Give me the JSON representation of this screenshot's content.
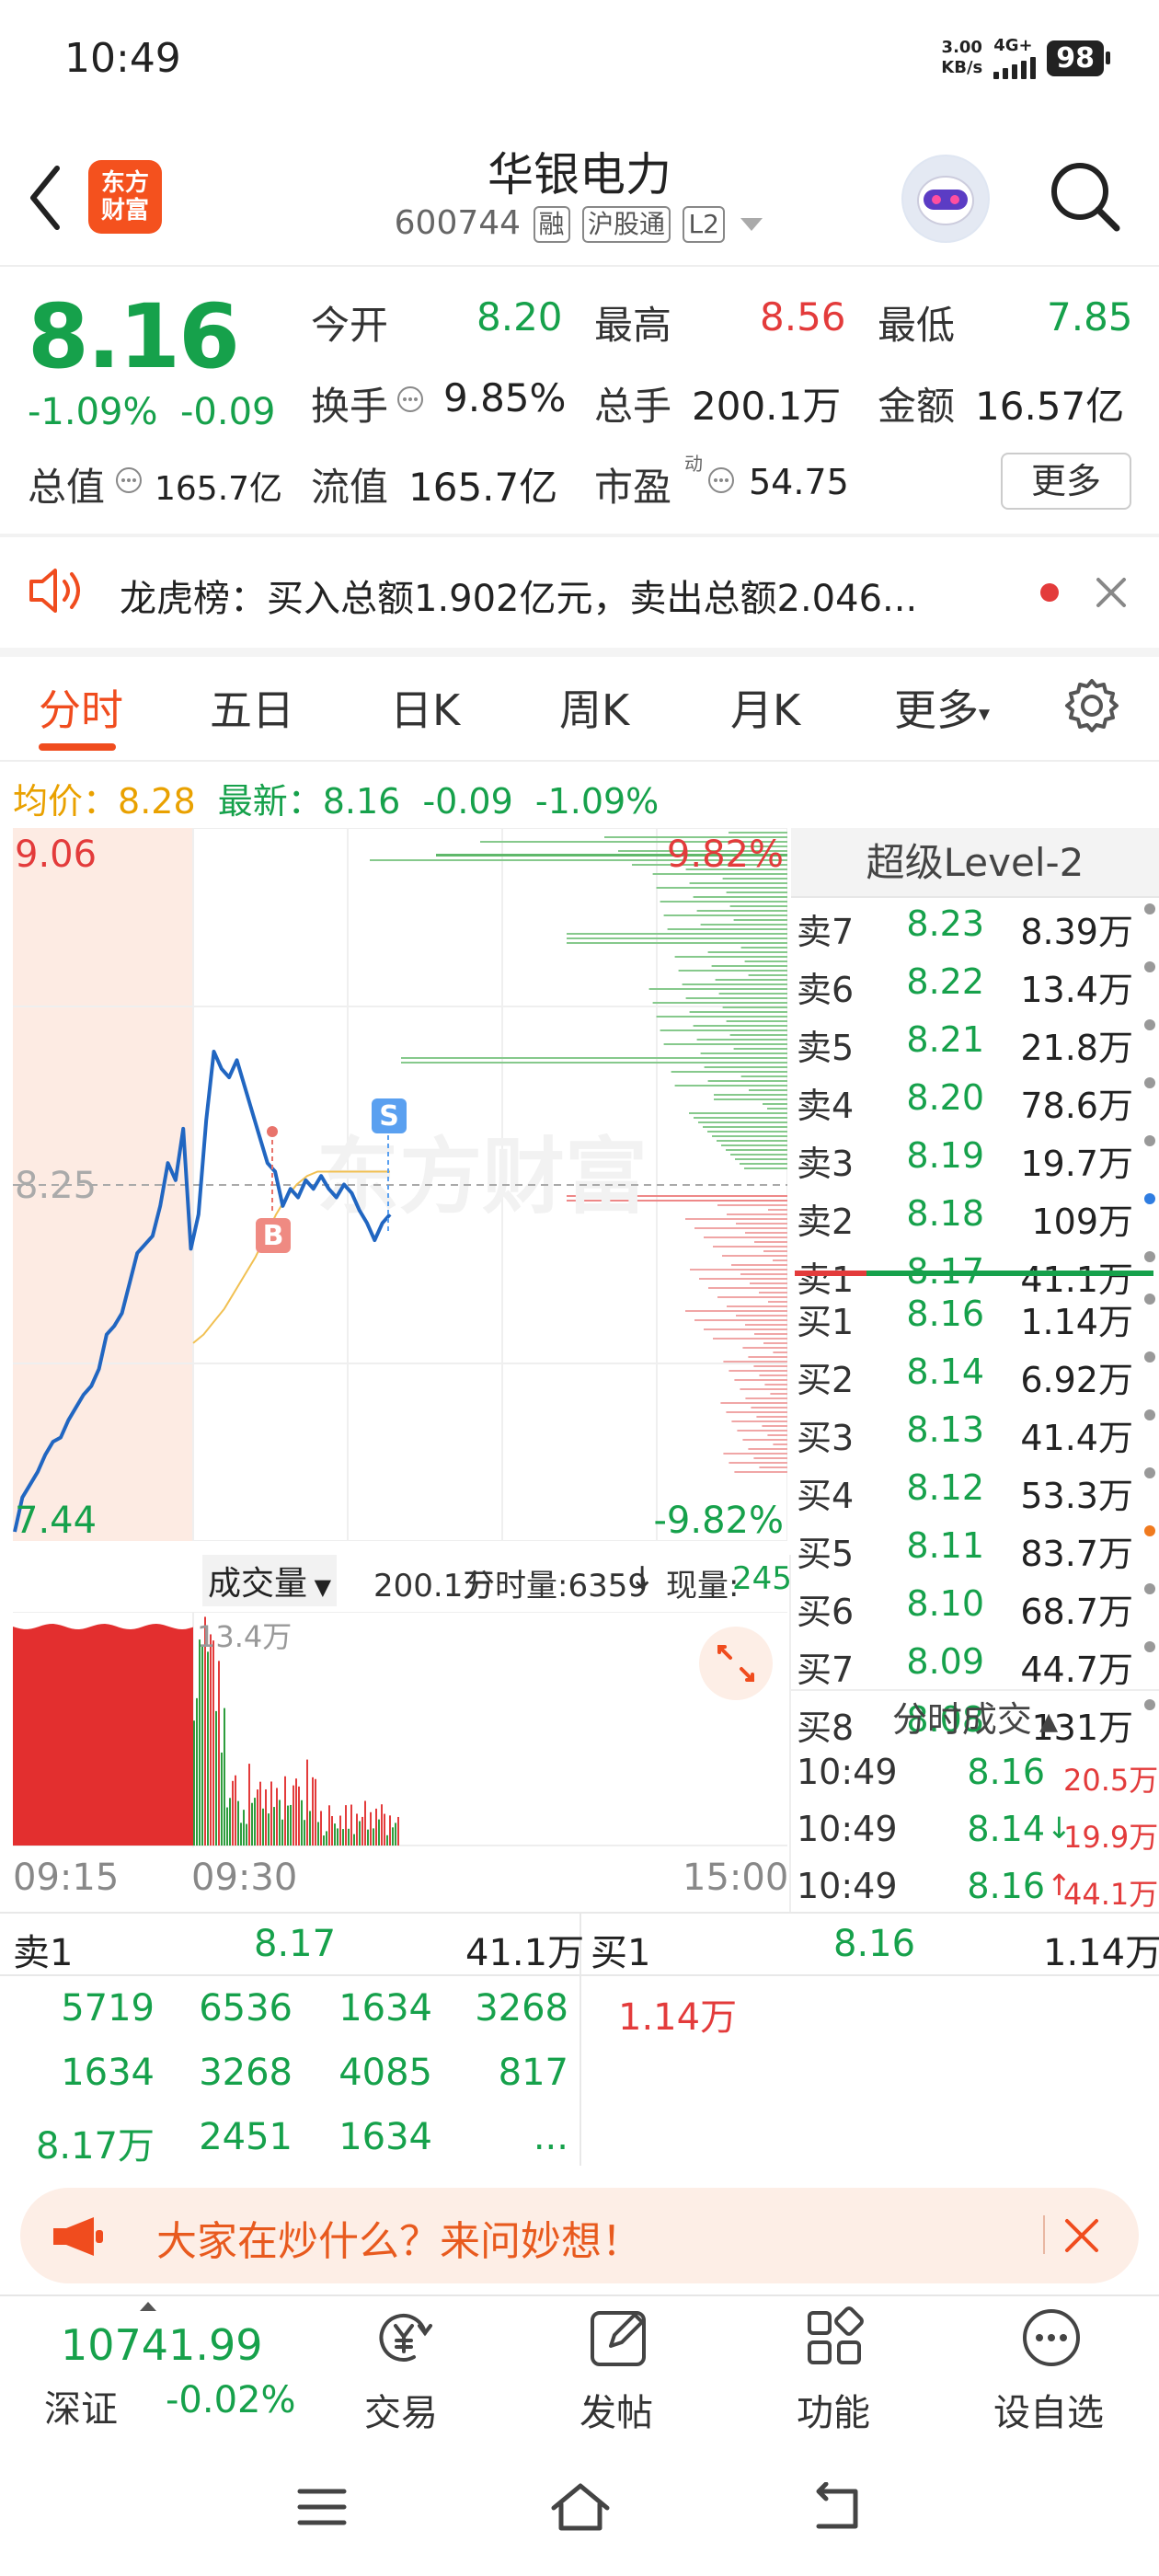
{
  "status_bar": {
    "time": "10:49",
    "speed_value": "3.00",
    "speed_unit": "KB/s",
    "network": "4G+",
    "battery": "98"
  },
  "header": {
    "title": "华银电力",
    "code": "600744",
    "tags": [
      "融",
      "沪股通",
      "L2"
    ],
    "logo_text": "东方财富"
  },
  "quote": {
    "price": "8.16",
    "change_pct": "-1.09%",
    "change": "-0.09",
    "fields": [
      {
        "label": "今开",
        "value": "8.20"
      },
      {
        "label": "最高",
        "value": "8.56"
      },
      {
        "label": "最低",
        "value": "7.85"
      },
      {
        "label": "换手",
        "value": "9.85%"
      },
      {
        "label": "总手",
        "value": "200.1万"
      },
      {
        "label": "金额",
        "value": "16.57亿"
      },
      {
        "label": "总值",
        "value": "165.7亿"
      },
      {
        "label": "流值",
        "value": "165.7亿"
      },
      {
        "label": "市盈",
        "value": "54.75"
      }
    ],
    "pe_superscript": "动",
    "more_button": "更多"
  },
  "news": {
    "text": "龙虎榜：买入总额1.902亿元，卖出总额2.046..."
  },
  "tabs": [
    "分时",
    "五日",
    "日K",
    "周K",
    "月K",
    "更多"
  ],
  "active_tab": "分时",
  "chart_info": {
    "avg_label": "均价：",
    "avg_value": "8.28",
    "latest_label": "最新：",
    "latest_value": "8.16",
    "change": "-0.09",
    "change_pct": "-1.09%"
  },
  "chart_data": {
    "type": "line",
    "title": "",
    "ylim": [
      7.44,
      9.06
    ],
    "y_labels": {
      "top": "9.06",
      "mid": "8.25",
      "bottom": "7.44"
    },
    "pct_labels": {
      "top": "9.82%",
      "bottom": "-9.82%"
    },
    "watermark": "东方财富",
    "x_labels": [
      "09:15",
      "09:30",
      "15:00"
    ],
    "series": [
      {
        "values": [
          7.44,
          7.52,
          7.55,
          7.58,
          7.62,
          7.65,
          7.66,
          7.7,
          7.73,
          7.76,
          7.78,
          7.82,
          7.9,
          7.92,
          7.95,
          8.02,
          8.09,
          8.11,
          8.13,
          8.2,
          8.3,
          8.26,
          8.38,
          8.1,
          8.18,
          8.4,
          8.56,
          8.52,
          8.5,
          8.54,
          8.48,
          8.42,
          8.36,
          8.3,
          8.28,
          8.2,
          8.24,
          8.22,
          8.26,
          8.24,
          8.27,
          8.24,
          8.22,
          8.25,
          8.23,
          8.19,
          8.16,
          8.12,
          8.16,
          8.18
        ]
      },
      {
        "values": [
          7.88,
          7.9,
          7.93,
          7.96,
          8.0,
          8.04,
          8.08,
          8.13,
          8.18,
          8.22,
          8.25,
          8.27,
          8.28,
          8.28,
          8.28,
          8.28,
          8.28,
          8.28,
          8.28,
          8.28
        ]
      }
    ],
    "markers": [
      {
        "label": "B"
      },
      {
        "label": "S"
      }
    ]
  },
  "order_book": {
    "title": "超级Level-2",
    "asks": [
      {
        "label": "卖7",
        "price": "8.23",
        "vol": "8.39万"
      },
      {
        "label": "卖6",
        "price": "8.22",
        "vol": "13.4万"
      },
      {
        "label": "卖5",
        "price": "8.21",
        "vol": "21.8万"
      },
      {
        "label": "卖4",
        "price": "8.20",
        "vol": "78.6万"
      },
      {
        "label": "卖3",
        "price": "8.19",
        "vol": "19.7万"
      },
      {
        "label": "卖2",
        "price": "8.18",
        "vol": "109万"
      },
      {
        "label": "卖1",
        "price": "8.17",
        "vol": "41.1万"
      }
    ],
    "bids": [
      {
        "label": "买1",
        "price": "8.16",
        "vol": "1.14万"
      },
      {
        "label": "买2",
        "price": "8.14",
        "vol": "6.92万"
      },
      {
        "label": "买3",
        "price": "8.13",
        "vol": "41.4万"
      },
      {
        "label": "买4",
        "price": "8.12",
        "vol": "53.3万"
      },
      {
        "label": "买5",
        "price": "8.11",
        "vol": "83.7万"
      },
      {
        "label": "买6",
        "price": "8.10",
        "vol": "68.7万"
      },
      {
        "label": "买7",
        "price": "8.09",
        "vol": "44.7万"
      },
      {
        "label": "买8",
        "price": "8.08",
        "vol": "131万"
      }
    ]
  },
  "volume": {
    "label": "成交量",
    "total": "200.1万",
    "minute_label": "分时量:6359",
    "arrow": "↓",
    "current_label": "现量:",
    "current_value": "245",
    "peak_label": "13.4万"
  },
  "time_trades": {
    "title": "分时成交",
    "rows": [
      {
        "time": "10:49",
        "price": "8.16",
        "vol": "20.5万",
        "arrow": ""
      },
      {
        "time": "10:49",
        "price": "8.14",
        "vol": "19.9万",
        "arrow": "↓"
      },
      {
        "time": "10:49",
        "price": "8.16",
        "vol": "44.1万",
        "arrow": "↑"
      }
    ]
  },
  "level_detail": {
    "ask": {
      "label": "卖1",
      "price": "8.17",
      "vol": "41.1万",
      "orders": [
        [
          "5719",
          "6536",
          "1634",
          "3268"
        ],
        [
          "1634",
          "3268",
          "4085",
          "817"
        ],
        [
          "8.17万",
          "2451",
          "1634",
          "..."
        ]
      ]
    },
    "bid": {
      "label": "买1",
      "price": "8.16",
      "vol": "1.14万",
      "orders": [
        [
          "1.14万"
        ]
      ]
    }
  },
  "banner": {
    "text": "大家在炒什么？来问妙想！"
  },
  "bottom_nav": {
    "index_value": "10741.99",
    "index_name": "深证",
    "index_change": "-0.02%",
    "items": [
      "交易",
      "发帖",
      "功能",
      "设自选"
    ]
  },
  "colors": {
    "up": "#e33b3b",
    "down": "#16a14b",
    "accent": "#f04c1e",
    "avg": "#e9a100",
    "line": "#2166c1"
  }
}
